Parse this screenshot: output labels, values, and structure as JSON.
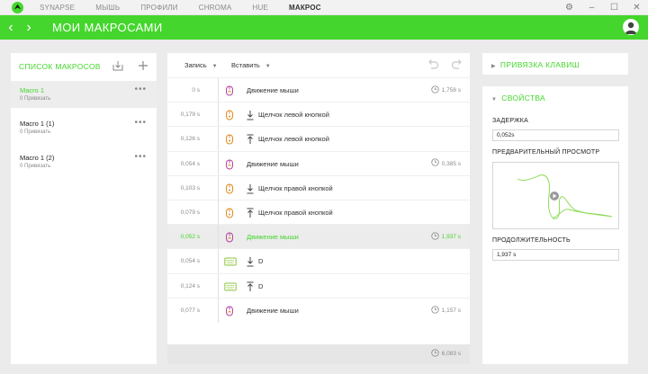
{
  "app": {
    "tabs": [
      "SYNAPSE",
      "МЫШЬ",
      "ПРОФИЛИ",
      "CHROMA",
      "HUE",
      "МАКРОС"
    ],
    "active_tab_index": 5,
    "accent_color": "#44d62c"
  },
  "header": {
    "title": "МОИ МАКРОСАМИ"
  },
  "macro_list": {
    "title": "СПИСОК МАКРОСОВ",
    "items": [
      {
        "name": "Macro 1",
        "binding": "0 Привязать",
        "active": true
      },
      {
        "name": "Macro 1 (1)",
        "binding": "0 Привязать",
        "active": false
      },
      {
        "name": "Macro 1 (2)",
        "binding": "0 Привязать",
        "active": false
      }
    ],
    "more_label": "•••"
  },
  "editor": {
    "record_label": "Запись",
    "insert_label": "Вставить",
    "events": [
      {
        "delay": "0 s",
        "device": "mouse",
        "direction": "",
        "label": "Движение мыши",
        "duration": "1,758 s",
        "active": false
      },
      {
        "delay": "0,179 s",
        "device": "mouse",
        "direction": "down",
        "label": "Щелчок левой кнопкой",
        "duration": "",
        "active": false
      },
      {
        "delay": "0,126 s",
        "device": "mouse",
        "direction": "up",
        "label": "Щелчок левой кнопкой",
        "duration": "",
        "active": false
      },
      {
        "delay": "0,054 s",
        "device": "mouse",
        "direction": "",
        "label": "Движение мыши",
        "duration": "0,385 s",
        "active": false
      },
      {
        "delay": "0,103 s",
        "device": "mouse",
        "direction": "down",
        "label": "Щелчок правой кнопкой",
        "duration": "",
        "active": false
      },
      {
        "delay": "0,079 s",
        "device": "mouse",
        "direction": "up",
        "label": "Щелчок правой кнопкой",
        "duration": "",
        "active": false
      },
      {
        "delay": "0,052 s",
        "device": "mouse",
        "direction": "",
        "label": "Движение мыши",
        "duration": "1,937 s",
        "active": true
      },
      {
        "delay": "0,054 s",
        "device": "keyboard",
        "direction": "down",
        "label": "D",
        "duration": "",
        "active": false
      },
      {
        "delay": "0,124 s",
        "device": "keyboard",
        "direction": "up",
        "label": "D",
        "duration": "",
        "active": false
      },
      {
        "delay": "0,077 s",
        "device": "mouse",
        "direction": "",
        "label": "Движение мыши",
        "duration": "1,157 s",
        "active": false
      }
    ],
    "total": "6,083 s"
  },
  "key_binding": {
    "title": "ПРИВЯЗКА КЛАВИШ"
  },
  "properties": {
    "title": "СВОЙСТВА",
    "delay_label": "ЗАДЕРЖКА",
    "delay_value": "0,052s",
    "preview_label": "ПРЕДВАРИТЕЛЬНЫЙ ПРОСМОТР",
    "duration_label": "ПРОДОЛЖИТЕЛЬНОСТЬ",
    "duration_value": "1,937 s"
  }
}
